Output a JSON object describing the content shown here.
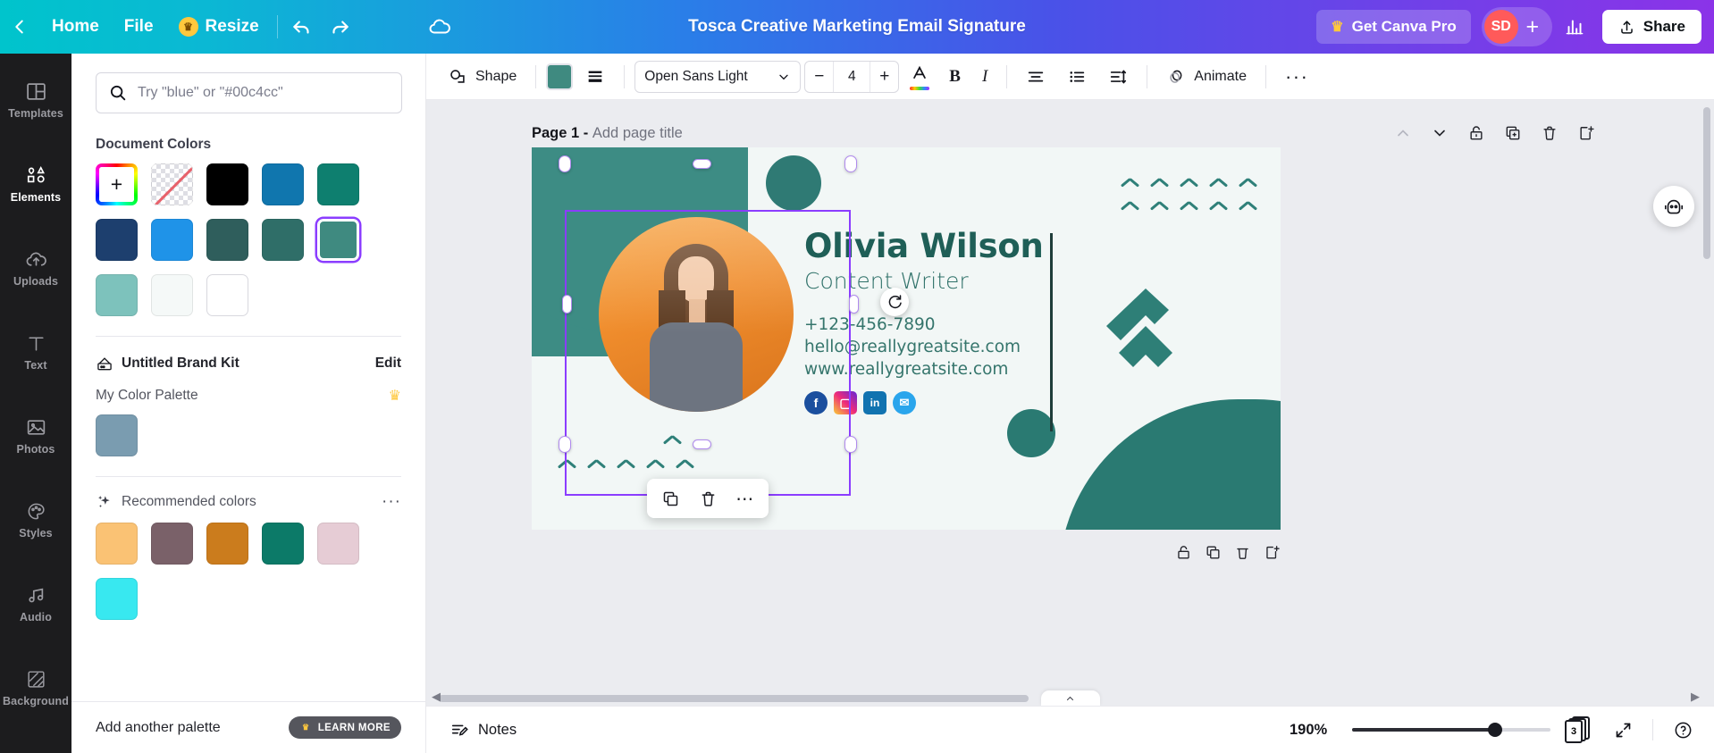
{
  "topbar": {
    "back_icon": "chevron-left-icon",
    "home": "Home",
    "file": "File",
    "resize": "Resize",
    "resize_icon": "crown-icon",
    "undo_icon": "undo-icon",
    "redo_icon": "redo-icon",
    "cloud_icon": "cloud-saved-icon",
    "title": "Tosca Creative Marketing Email Signature",
    "pro_label": "Get Canva Pro",
    "avatar_initials": "SD",
    "plus_label": "+",
    "stats_icon": "bar-chart-icon",
    "share_label": "Share",
    "share_icon": "share-upload-icon"
  },
  "rail": {
    "items": [
      {
        "label": "Templates",
        "icon": "templates-icon",
        "active": false
      },
      {
        "label": "Elements",
        "icon": "elements-icon",
        "active": true
      },
      {
        "label": "Uploads",
        "icon": "uploads-icon",
        "active": false
      },
      {
        "label": "Text",
        "icon": "text-icon",
        "active": false
      },
      {
        "label": "Photos",
        "icon": "photos-icon",
        "active": false
      },
      {
        "label": "Styles",
        "icon": "styles-icon",
        "active": false
      },
      {
        "label": "Audio",
        "icon": "audio-icon",
        "active": false
      },
      {
        "label": "Background",
        "icon": "background-icon",
        "active": false
      }
    ]
  },
  "panel": {
    "search_placeholder": "Try \"blue\" or \"#00c4cc\"",
    "document_colors_title": "Document Colors",
    "document_colors": [
      {
        "name": "custom-color-picker",
        "hex": "rainbow",
        "selected": false
      },
      {
        "name": "transparent",
        "hex": "transparent",
        "selected": false
      },
      {
        "name": "black",
        "hex": "#000000",
        "selected": false
      },
      {
        "name": "blue",
        "hex": "#1076ae",
        "selected": false
      },
      {
        "name": "teal-green",
        "hex": "#0e7f6f",
        "selected": false
      },
      {
        "name": "navy",
        "hex": "#1d3f6e",
        "selected": false
      },
      {
        "name": "bright-blue",
        "hex": "#1f93e8",
        "selected": false
      },
      {
        "name": "dark-teal",
        "hex": "#2f5e5c",
        "selected": false
      },
      {
        "name": "teal",
        "hex": "#2f6e68",
        "selected": false
      },
      {
        "name": "selected-teal",
        "hex": "#3f8a80",
        "selected": true
      },
      {
        "name": "light-teal",
        "hex": "#7dc2bc",
        "selected": false
      },
      {
        "name": "off-white",
        "hex": "#f5f9f8",
        "selected": false
      },
      {
        "name": "white",
        "hex": "#ffffff",
        "selected": false
      }
    ],
    "brand_kit_name": "Untitled Brand Kit",
    "brand_kit_icon": "brand-kit-icon",
    "edit_label": "Edit",
    "my_palette_title": "My Color Palette",
    "my_palette_badge_icon": "crown-icon",
    "my_palette_colors": [
      {
        "name": "steel-blue",
        "hex": "#7a9cb0"
      }
    ],
    "recommended_title": "Recommended colors",
    "recommended_icon": "sparkle-icon",
    "recommended_more": "···",
    "recommended_colors": [
      {
        "name": "light-orange",
        "hex": "#fac274"
      },
      {
        "name": "mauve-grey",
        "hex": "#7a6169"
      },
      {
        "name": "amber",
        "hex": "#cb7c1d"
      },
      {
        "name": "emerald",
        "hex": "#0c7a68"
      },
      {
        "name": "pale-pink",
        "hex": "#e6ccd5"
      },
      {
        "name": "cyan",
        "hex": "#38e8f0"
      }
    ],
    "add_palette_label": "Add another palette",
    "learn_more_label": "LEARN MORE"
  },
  "toolbar": {
    "shape_label": "Shape",
    "shape_icon": "shape-icon",
    "fill_color": "#3f8a80",
    "border_icon": "border-style-icon",
    "font_family": "Open Sans Light",
    "font_size": "4",
    "minus_label": "−",
    "plus_label": "+",
    "text_color_icon": "text-color-icon",
    "bold_label": "B",
    "italic_label": "I",
    "align_icon": "text-align-icon",
    "list_icon": "bullet-list-icon",
    "spacing_icon": "line-spacing-icon",
    "animate_label": "Animate",
    "animate_icon": "animate-icon",
    "more_label": "···"
  },
  "canvas": {
    "page_label": "Page 1 -",
    "page_title_placeholder": "Add page title",
    "page_tools": [
      {
        "name": "move-up-icon",
        "glyph": "chevron-up",
        "dim": true
      },
      {
        "name": "move-down-icon",
        "glyph": "chevron-down",
        "dim": false
      },
      {
        "name": "lock-icon",
        "glyph": "lock",
        "dim": false
      },
      {
        "name": "duplicate-page-icon",
        "glyph": "duplicate",
        "dim": false
      },
      {
        "name": "delete-page-icon",
        "glyph": "trash",
        "dim": false
      },
      {
        "name": "add-page-icon",
        "glyph": "add-page",
        "dim": false
      }
    ],
    "design": {
      "name": "Olivia Wilson",
      "role": "Content Writer",
      "phone": "+123-456-7890",
      "email": "hello@reallygreatsite.com",
      "website": "www.reallygreatsite.com",
      "social": [
        {
          "name": "facebook-icon",
          "glyph": "f"
        },
        {
          "name": "instagram-icon",
          "glyph": "◎"
        },
        {
          "name": "linkedin-icon",
          "glyph": "in"
        },
        {
          "name": "twitter-icon",
          "glyph": "ᵗ"
        }
      ]
    },
    "context_menu": [
      {
        "name": "duplicate-icon"
      },
      {
        "name": "delete-icon"
      },
      {
        "name": "more-options-icon"
      }
    ],
    "rotate_icon": "rotate-handle-icon",
    "helper_icon": "assistant-icon"
  },
  "bottombar": {
    "notes_label": "Notes",
    "notes_icon": "notes-icon",
    "zoom_level": "190%",
    "page_count": "3",
    "pages_icon": "page-manager-icon",
    "fullscreen_icon": "fullscreen-icon",
    "help_icon": "help-icon"
  }
}
